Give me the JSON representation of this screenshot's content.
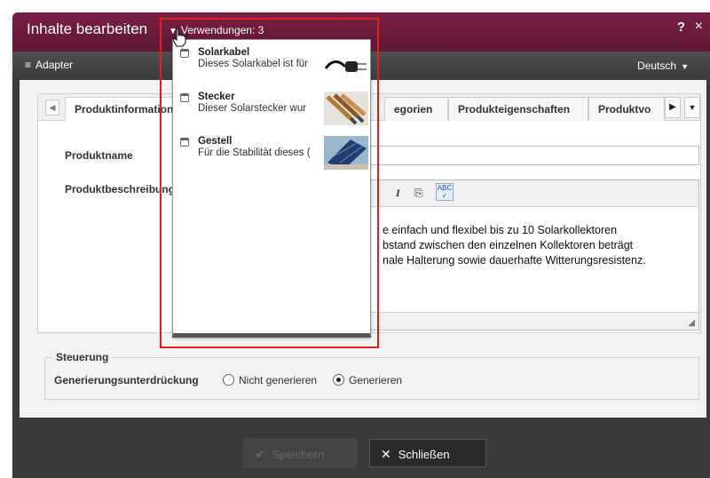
{
  "dialog": {
    "title": "Inhalte bearbeiten",
    "usage_label": "Verwendungen: 3",
    "help": "?",
    "close": "×"
  },
  "toolbar": {
    "adapter": "Adapter",
    "language": "Deutsch"
  },
  "tabs": [
    {
      "label": "Produktinformation",
      "active": true
    },
    {
      "label": "egorien"
    },
    {
      "label": "Produkteigenschaften"
    },
    {
      "label": "Produktvo"
    }
  ],
  "form": {
    "name_label": "Produktname",
    "desc_label": "Produktbeschreibung",
    "desc_lines": [
      "e einfach und flexibel bis zu 10 Solarkollektoren",
      "bstand zwischen den einzelnen Kollektoren beträgt",
      "nale Halterung sowie dauerhafte Witterungsresistenz."
    ]
  },
  "control": {
    "legend": "Steuerung",
    "label": "Generierungsunterdrückung",
    "options": [
      "Nicht generieren",
      "Generieren"
    ],
    "selected": "Generieren"
  },
  "buttons": {
    "save": "Speichern",
    "close": "Schließen"
  },
  "usages": [
    {
      "title": "Solarkabel",
      "desc": "Dieses Solarkabel ist für",
      "thumb": "cable-plug"
    },
    {
      "title": "Stecker",
      "desc": "Dieser Solarstecker wur",
      "thumb": "connectors"
    },
    {
      "title": "Gestell",
      "desc": "Für die Stabilität dieses (",
      "thumb": "solar-panel"
    }
  ],
  "colors": {
    "titlebar": "#6a1a3c",
    "highlight": "#e02020"
  }
}
